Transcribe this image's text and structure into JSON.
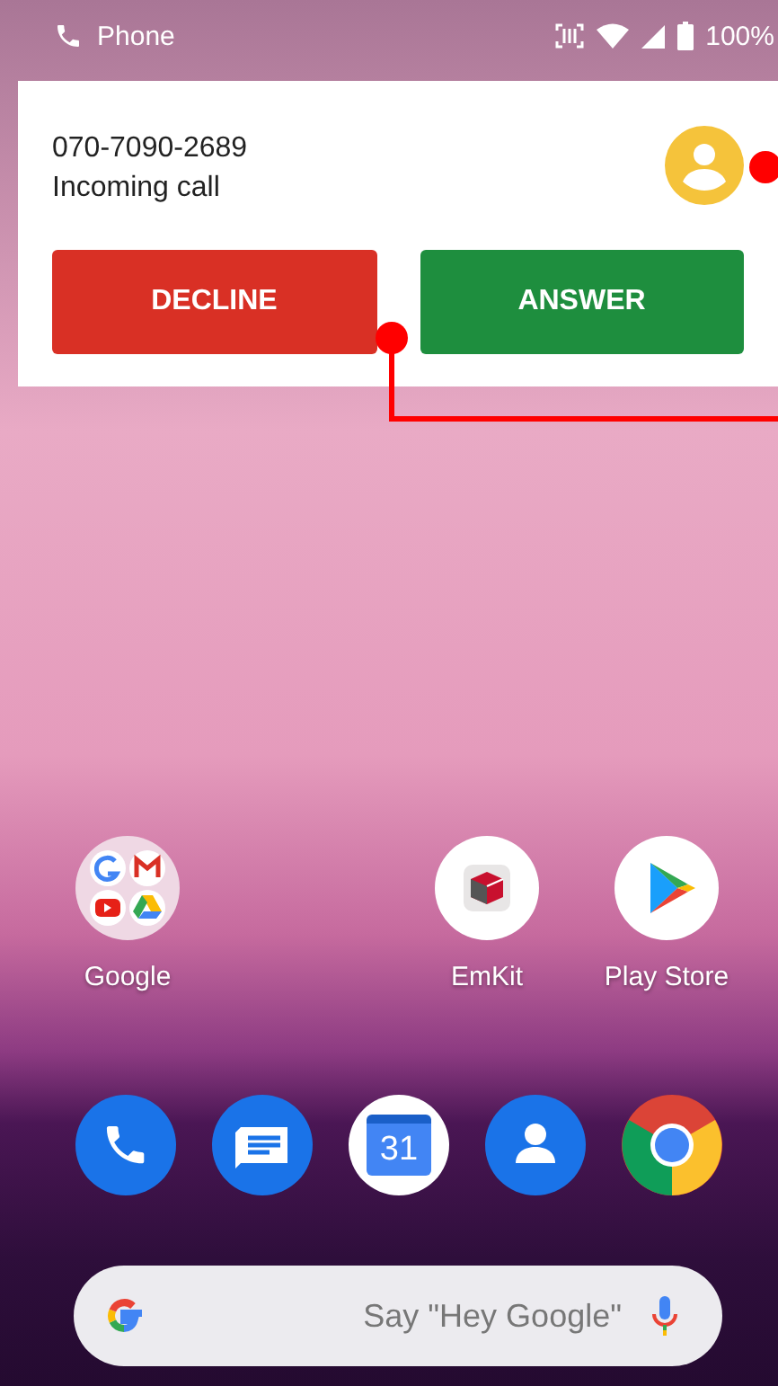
{
  "status_bar": {
    "app": "Phone",
    "battery": "100%"
  },
  "call_notification": {
    "number": "070-7090-2689",
    "status": "Incoming call",
    "buttons": [
      {
        "label": "DECLINE",
        "kind": "decline"
      },
      {
        "label": "ANSWER",
        "kind": "answer"
      }
    ]
  },
  "home_apps": [
    {
      "label": "Google",
      "kind": "folder"
    },
    {
      "label": "EmKit",
      "kind": "emkit"
    },
    {
      "label": "Play Store",
      "kind": "play"
    }
  ],
  "dock": [
    {
      "kind": "phone"
    },
    {
      "kind": "messages"
    },
    {
      "kind": "calendar",
      "text": "31"
    },
    {
      "kind": "contacts"
    },
    {
      "kind": "chrome"
    }
  ],
  "search_bar": {
    "placeholder": "Say \"Hey Google\""
  }
}
